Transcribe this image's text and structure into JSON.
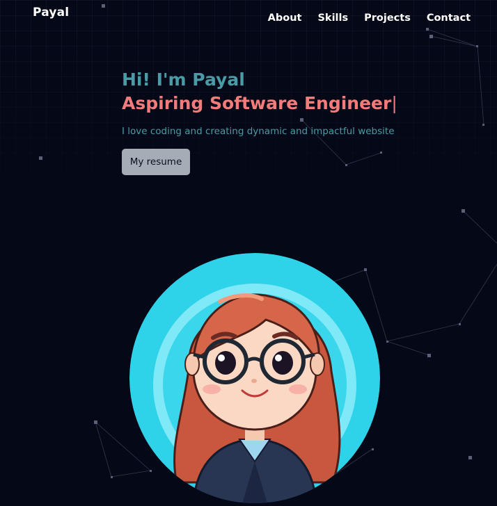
{
  "nav": {
    "brand": "Payal",
    "links": [
      "About",
      "Skills",
      "Projects",
      "Contact"
    ]
  },
  "hero": {
    "greeting": "Hi! I'm Payal",
    "role": "Aspiring Software Engineer",
    "cursor": "|",
    "tagline": "I love coding and creating dynamic and impactful website",
    "resume_button": "My resume"
  },
  "colors": {
    "background": "#050816",
    "greeting": "#4a9ba5",
    "role": "#f27b7b",
    "avatar_ring": "#2ed3ea",
    "button_bg": "#a6acb6"
  },
  "icons": {
    "avatar": "cartoon-girl-avatar"
  }
}
